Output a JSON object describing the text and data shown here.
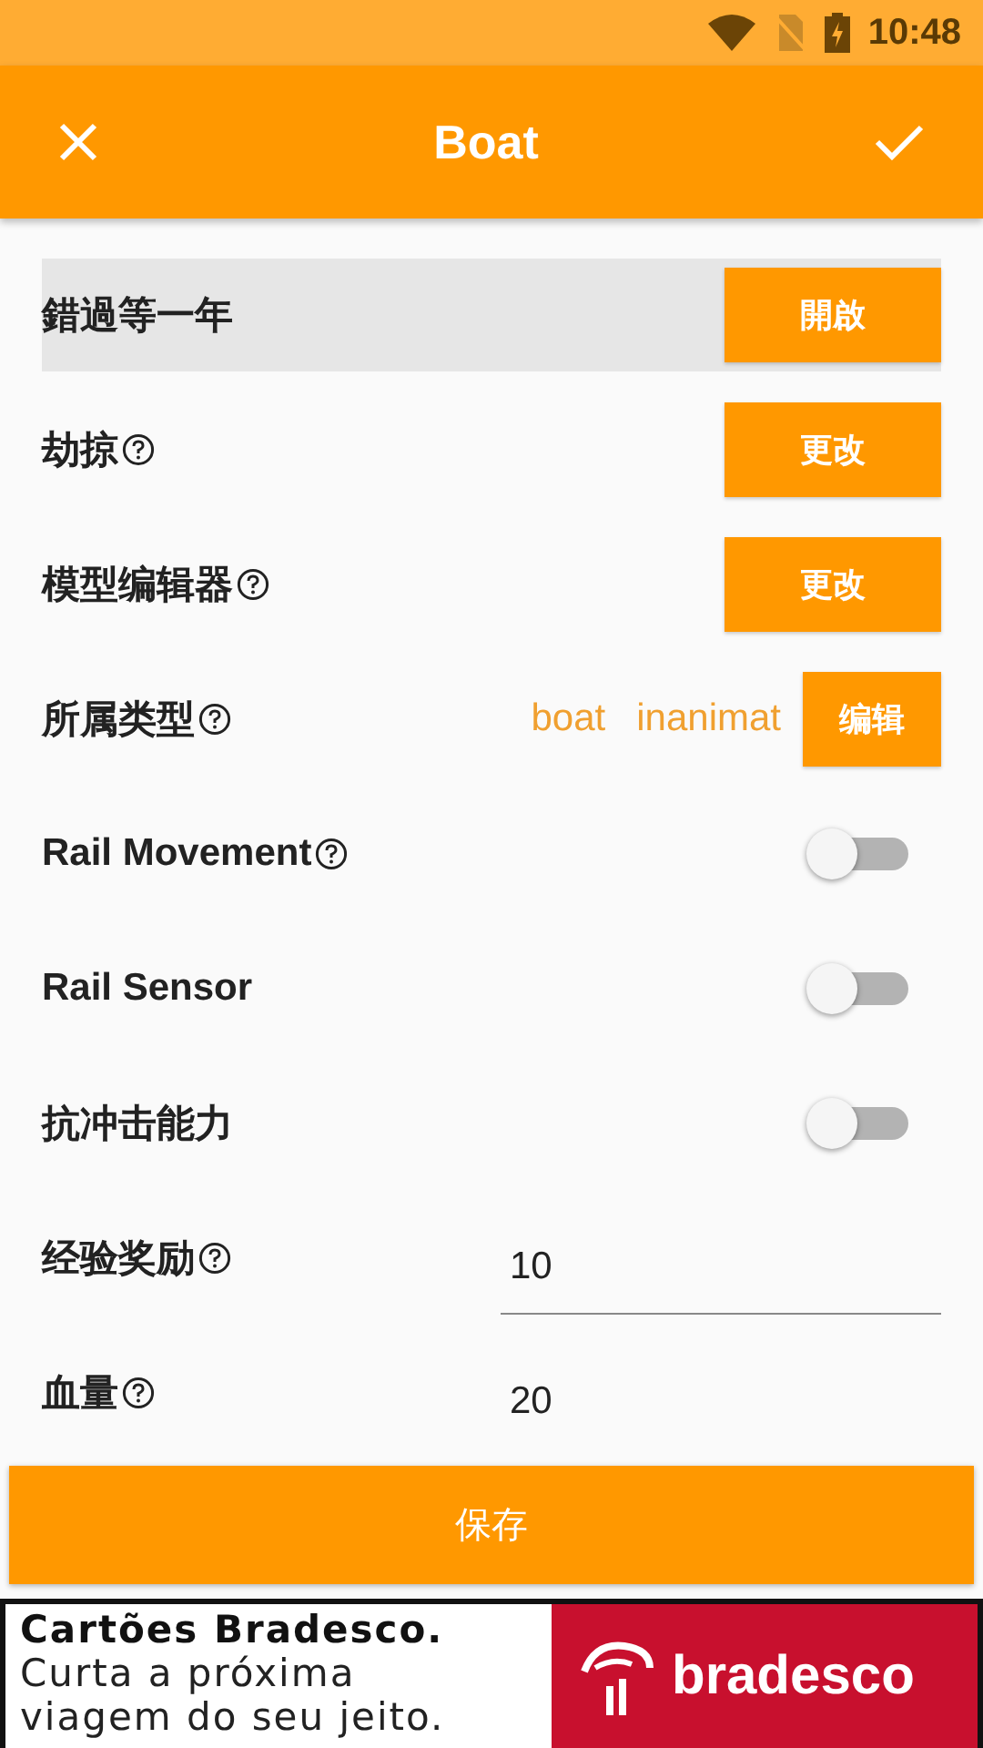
{
  "status_bar": {
    "time": "10:48"
  },
  "app_bar": {
    "title": "Boat"
  },
  "rows": [
    {
      "kind": "button",
      "label": "錯過等一年",
      "help": false,
      "highlighted": true,
      "button": "開啟"
    },
    {
      "kind": "button",
      "label": "劫掠",
      "help": true,
      "highlighted": false,
      "button": "更改"
    },
    {
      "kind": "button",
      "label": "模型编辑器",
      "help": true,
      "highlighted": false,
      "button": "更改"
    },
    {
      "kind": "tags",
      "label": "所属类型",
      "help": true,
      "highlighted": false,
      "tags": [
        "boat",
        "inanimat"
      ],
      "button": "编辑"
    },
    {
      "kind": "switch",
      "label": "Rail Movement",
      "help": true,
      "highlighted": false,
      "on": false
    },
    {
      "kind": "switch",
      "label": "Rail Sensor",
      "help": false,
      "highlighted": false,
      "on": false
    },
    {
      "kind": "switch",
      "label": "抗冲击能力",
      "help": false,
      "highlighted": false,
      "on": false
    },
    {
      "kind": "field",
      "label": "经验奖励",
      "help": true,
      "highlighted": false,
      "value": "10",
      "underline": true
    },
    {
      "kind": "field",
      "label": "血量",
      "help": true,
      "highlighted": false,
      "value": "20",
      "underline": false
    }
  ],
  "save_button": "保存",
  "ad": {
    "headline": "Cartões Bradesco.",
    "lines": [
      "Curta a próxima",
      "viagem do seu jeito."
    ],
    "brand": "bradesco"
  }
}
